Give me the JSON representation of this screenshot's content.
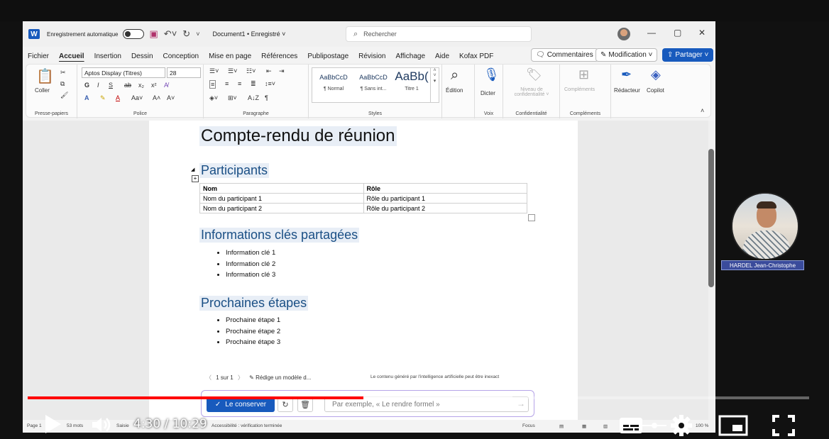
{
  "titlebar": {
    "autosave_label": "Enregistrement automatique",
    "doc_name": "Document1 • Enregistré ˅",
    "search_placeholder": "Rechercher"
  },
  "tabs": [
    "Fichier",
    "Accueil",
    "Insertion",
    "Dessin",
    "Conception",
    "Mise en page",
    "Références",
    "Publipostage",
    "Révision",
    "Affichage",
    "Aide",
    "Kofax PDF"
  ],
  "active_tab": "Accueil",
  "ribbon_buttons": {
    "comments": "Commentaires",
    "modification": "Modification ˅",
    "share": "Partager ˅"
  },
  "ribbon": {
    "paste": "Coller",
    "clipboard_label": "Presse-papiers",
    "font_name": "Aptos Display (Titres)",
    "font_size": "28",
    "font_label": "Police",
    "paragraph_label": "Paragraphe",
    "styles": [
      {
        "preview": "AaBbCcD",
        "name": "¶ Normal"
      },
      {
        "preview": "AaBbCcD",
        "name": "¶ Sans int..."
      },
      {
        "preview": "AaBb(",
        "name": "Titre 1"
      }
    ],
    "styles_label": "Styles",
    "editing": "Édition",
    "dictate": "Dicter",
    "voice_label": "Voix",
    "sensitivity": "Niveau de confidentialité ˅",
    "confidentiality_label": "Confidentialité",
    "addins": "Compléments",
    "addins_label": "Compléments",
    "editor": "Rédacteur",
    "copilot": "Copilot"
  },
  "document": {
    "title": "Compte-rendu de réunion",
    "section_participants": "Participants",
    "table_headers": [
      "Nom",
      "Rôle"
    ],
    "table_rows": [
      [
        "Nom du participant 1",
        "Rôle du participant 1"
      ],
      [
        "Nom du participant 2",
        "Rôle du participant 2"
      ]
    ],
    "section_info": "Informations clés partagées",
    "info_items": [
      "Information clé 1",
      "Information clé 2",
      "Information clé 3"
    ],
    "section_next": "Prochaines étapes",
    "next_items": [
      "Prochaine étape 1",
      "Prochaine étape 2",
      "Prochaine étape 3"
    ]
  },
  "copilot": {
    "pager": "1 sur 1",
    "draft_label": "Rédige un modèle d...",
    "disclaimer": "Le contenu généré par l'intelligence artificielle peut être inexact",
    "keep_button": "Le conserver",
    "input_placeholder": "Par exemple, « Le rendre formel »"
  },
  "statusbar": {
    "page": "Page 1",
    "words": "53 mots",
    "input": "Saisie",
    "accessibility": "Accessibilité : vérification terminée",
    "focus": "Focus",
    "zoom": "100 %"
  },
  "webcam": {
    "name": "HARDEL Jean-Christophe"
  },
  "player": {
    "current_time": "4:30",
    "duration": "10:29",
    "progress": 0.43,
    "buffered": 0.62,
    "accent_color": "#ff0000"
  }
}
